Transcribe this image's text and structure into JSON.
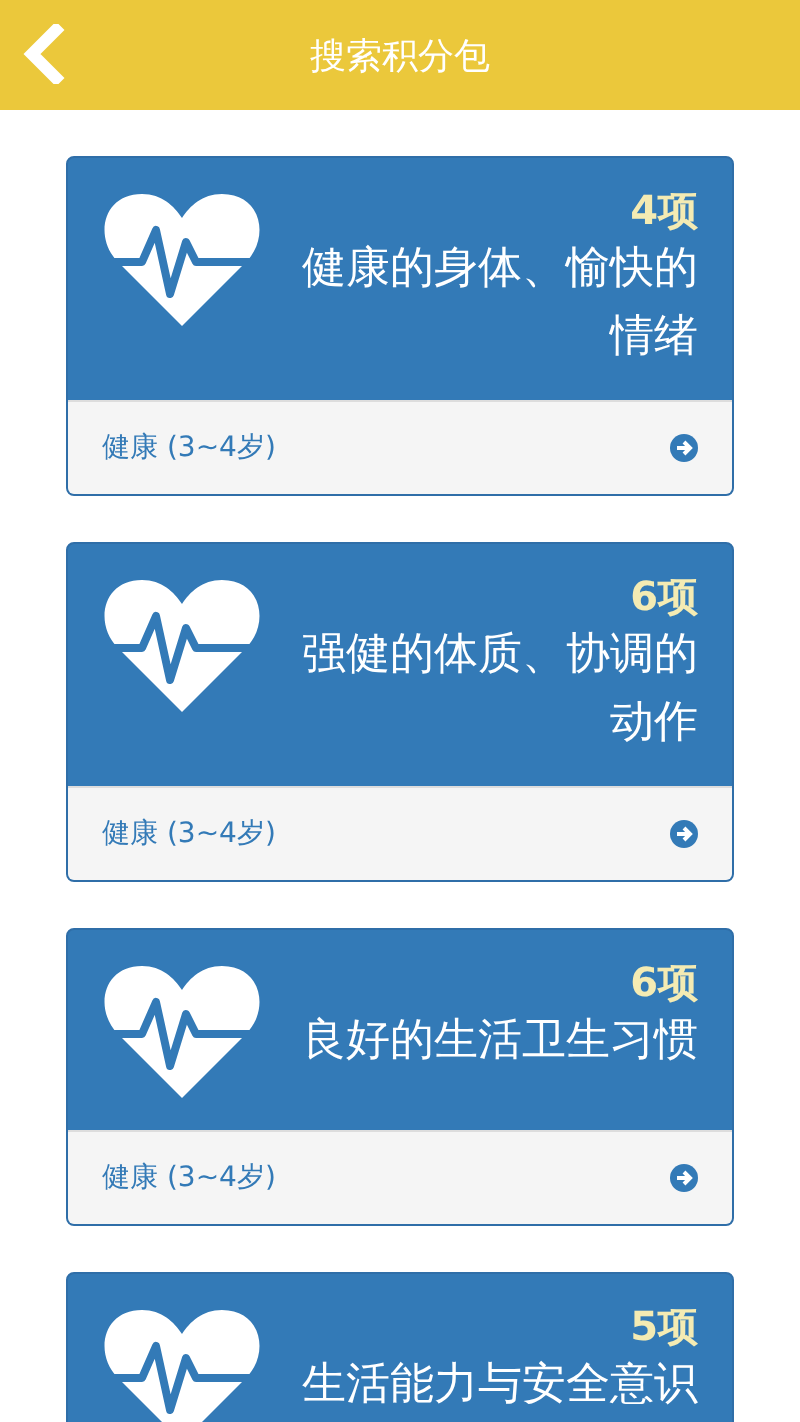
{
  "header": {
    "title": "搜索积分包"
  },
  "cards": [
    {
      "count": "4项",
      "title": "健康的身体、愉快的情绪",
      "category": "健康 (3~4岁)"
    },
    {
      "count": "6项",
      "title": "强健的体质、协调的动作",
      "category": "健康 (3~4岁)"
    },
    {
      "count": "6项",
      "title": "良好的生活卫生习惯",
      "category": "健康 (3~4岁)"
    },
    {
      "count": "5项",
      "title": "生活能力与安全意识"
    }
  ]
}
